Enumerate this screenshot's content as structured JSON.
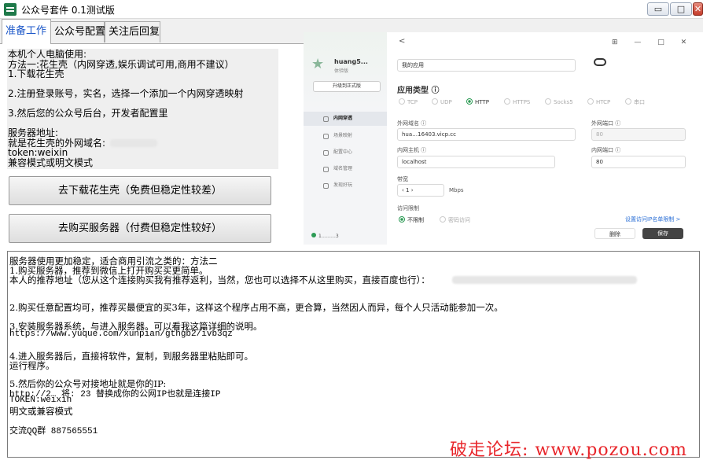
{
  "window": {
    "title": "公众号套件 0.1测试版",
    "min_glyph": "▭",
    "max_glyph": "□",
    "close_glyph": "✕",
    "icon": "app-logo-icon"
  },
  "tabs": [
    {
      "label": "准备工作",
      "active": true
    },
    {
      "label": "公众号配置",
      "active": false
    },
    {
      "label": "关注后回复",
      "active": false
    }
  ],
  "intro": {
    "lines": [
      "本机个人电脑使用:",
      "方法一:花生壳（内网穿透,娱乐调试可用,商用不建议）",
      "1.下载花生壳",
      "",
      "2.注册登录账号，实名，选择一个添加一个内网穿透映射",
      "",
      "3.然后您的公众号后台，开发者配置里",
      "",
      "服务器地址:",
      "就是花生壳的外网域名:",
      "token:weixin",
      "兼容模式或明文模式"
    ]
  },
  "buttons": {
    "download": "去下载花生壳（免费但稳定性较差）",
    "buy": "去购买服务器（付费但稳定性较好）"
  },
  "screenshot": {
    "back": "<",
    "toolbar": "⊞ — □ ✕",
    "account_name": "huang5...",
    "account_sub": "体验版",
    "upgrade": "升级到正式版",
    "nav": [
      "内网穿透",
      "场景映射",
      "配置中心",
      "域名管理",
      "发现好玩"
    ],
    "status_id": "1………3",
    "app_name": "我的应用",
    "section": "应用类型 ⓘ",
    "protocols": [
      "TCP",
      "UDP",
      "HTTP",
      "HTTPS",
      "Socks5",
      "HTCP",
      "串口"
    ],
    "selected_protocol": "HTTP",
    "ext_domain_label": "外网域名 ⓘ",
    "ext_domain": "hua…16403.vicp.cc",
    "ext_port_label": "外网端口 ⓘ",
    "ext_port": "80",
    "int_host_label": "内网主机 ⓘ",
    "int_host": "localhost",
    "int_port_label": "内网端口 ⓘ",
    "int_port": "80",
    "bandwidth_label": "带宽",
    "bandwidth": "‹    1    ›",
    "bandwidth_unit": "Mbps",
    "access_label": "访问限制",
    "access_opts": [
      "不限制",
      "密码访问"
    ],
    "whitelist_link": "设置访问IP名单限制 >",
    "delete": "删除",
    "save": "保存"
  },
  "notes": {
    "lines": [
      "服务器使用更加稳定，适合商用引流之类的：方法二",
      "1.购买服务器，推荐到微信上打开购买买更简单。",
      "本人的推荐地址（您从这个连接购买我有推荐返利，当然，您也可以选择不从这里购买，直接百度也行）：",
      "",
      "2.购买任意配置均可，推荐买最便宜的买3年，这样这个程序占用不高，更合算，当然因人而异，每个人只活动能参加一次。",
      "",
      "3.安装服务器系统，与进入服务器。可以看我这篇详细的说明。",
      "   https://www.yuque.com/xunpian/gthgb2/ivb3qz",
      "",
      "4.进入服务器后，直接将软件，复制，到服务器里粘贴即可。",
      "运行程序。",
      "",
      "5.然后你的公众号对接地址就是你的IP:",
      "http://2…          将: 23              替换成你的公网IP也就是连接IP",
      "TOKEN:weixin",
      "明文或兼容模式",
      "",
      "交流QQ群 887565551"
    ]
  },
  "watermark": "破走论坛: www.pozou.com"
}
